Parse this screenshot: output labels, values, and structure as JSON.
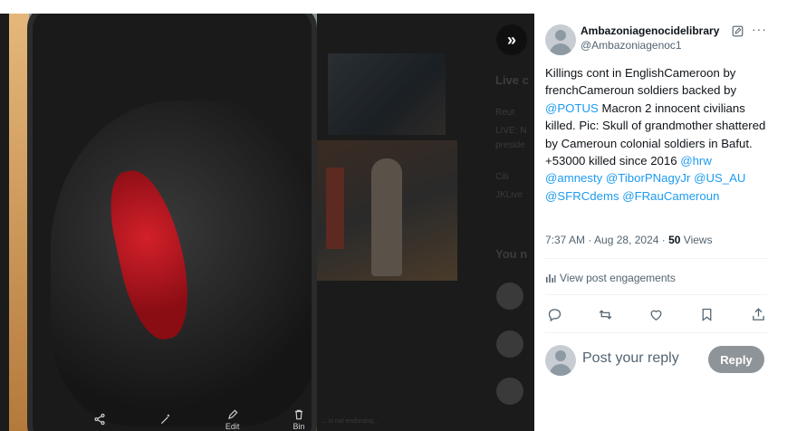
{
  "media": {
    "background_text": {
      "live_heading": "Live c",
      "news_label": "Reut",
      "live_line1": "LIVE: N",
      "live_line2": "preside",
      "citi_label": "Citi",
      "jklive_label": "JKLive",
      "you_heading": "You n",
      "footer_note": "... is not endorsing..."
    },
    "phone_toolbar": {
      "share_label": "",
      "enhance_label": "",
      "edit_label": "Edit",
      "bin_label": "Bin"
    }
  },
  "expand_button": {
    "glyph": "»"
  },
  "post": {
    "author_name": "Ambazoniagenocidelibrary",
    "author_handle": "@Ambazoniagenoc1",
    "text_parts": [
      {
        "t": "Killings cont in EnglishCameroon by frenchCameroun soldiers backed by ",
        "mention": false
      },
      {
        "t": "@POTUS",
        "mention": true
      },
      {
        "t": " Macron  2 innocent civilians killed. Pic: Skull of grandmother shattered by Cameroun colonial soldiers in Bafut. +53000 killed since 2016 ",
        "mention": false
      },
      {
        "t": "@hrw",
        "mention": true
      },
      {
        "t": "  ",
        "mention": false
      },
      {
        "t": "@amnesty",
        "mention": true
      },
      {
        "t": " ",
        "mention": false
      },
      {
        "t": "@TiborPNagyJr",
        "mention": true
      },
      {
        "t": " ",
        "mention": false
      },
      {
        "t": "@US_AU",
        "mention": true
      },
      {
        "t": " ",
        "mention": false
      },
      {
        "t": "@SFRCdems",
        "mention": true
      },
      {
        "t": " ",
        "mention": false
      },
      {
        "t": "@FRauCameroun",
        "mention": true
      }
    ],
    "time": "7:37 AM · Aug 28, 2024 · ",
    "views_count": "50",
    "views_label": " Views",
    "engagements_label": "View post engagements",
    "actions": [
      "reply-icon",
      "repost-icon",
      "like-icon",
      "bookmark-icon",
      "share-icon"
    ],
    "reply_placeholder": "Post your reply",
    "reply_button": "Reply"
  },
  "colors": {
    "accent": "#1d9bf0",
    "text": "#0f1419",
    "muted": "#536471",
    "reply_button": "#8f9499"
  }
}
